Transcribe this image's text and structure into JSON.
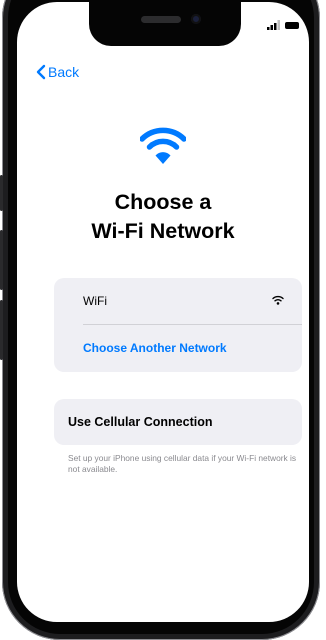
{
  "nav": {
    "back_label": "Back"
  },
  "title": {
    "line1": "Choose a",
    "line2": "Wi-Fi Network"
  },
  "networks": {
    "items": [
      {
        "label": "WiFi"
      }
    ],
    "other_label": "Choose Another Network"
  },
  "cellular": {
    "label": "Use Cellular Connection",
    "description": "Set up your iPhone using cellular data if your Wi-Fi network is not available."
  },
  "colors": {
    "accent": "#007aff",
    "card": "#efeff4",
    "footnote": "#8a8a8f"
  },
  "icons": {
    "back": "chevron-left-icon",
    "hero": "wifi-icon",
    "network": "wifi-signal-icon"
  }
}
